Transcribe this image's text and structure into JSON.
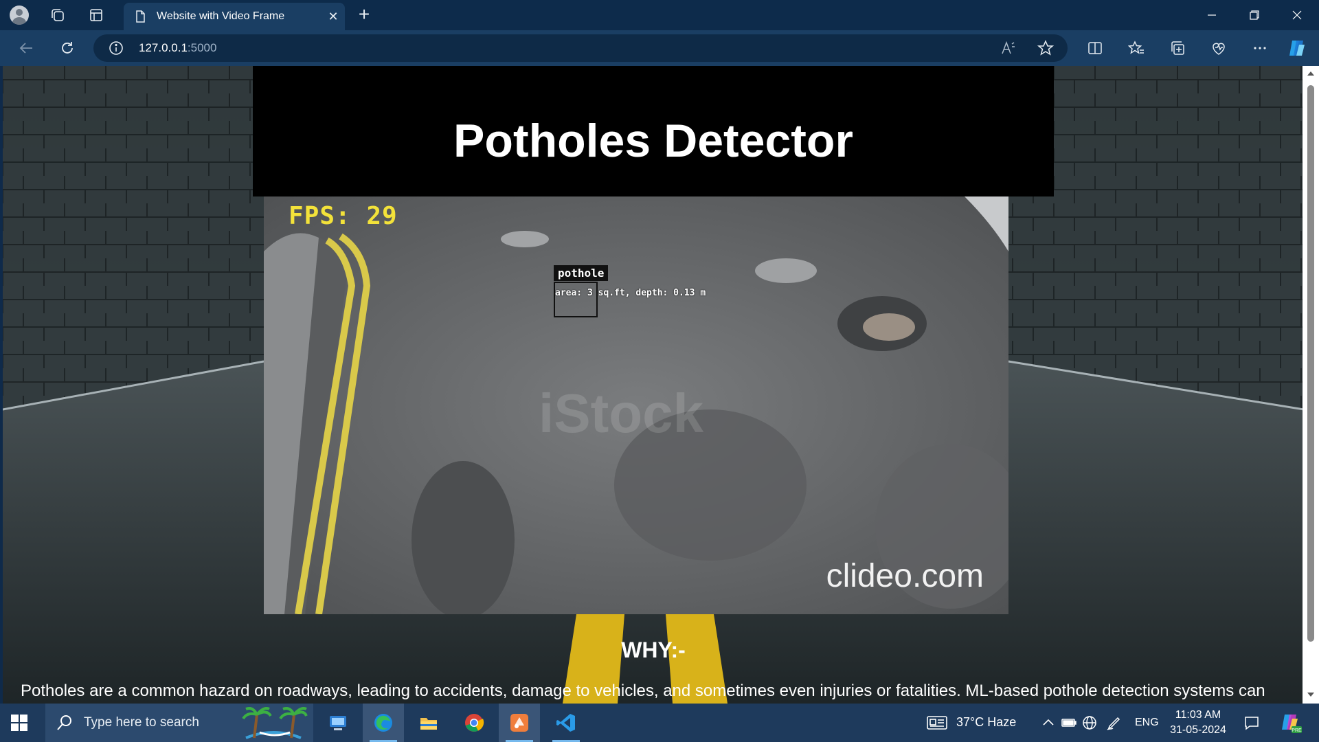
{
  "browser": {
    "tab_title": "Website with Video Frame",
    "url_host": "127.0.0.1",
    "url_port": ":5000"
  },
  "page": {
    "title": "Potholes Detector",
    "video": {
      "fps_label": "FPS: 29",
      "detection_label": "pothole",
      "detection_info": "area: 3 sq.ft, depth: 0.13 m",
      "watermark": "clideo.com",
      "stock_watermark": "iStock"
    },
    "why_heading": "WHY:-",
    "paragraph": "Potholes are a common hazard on roadways, leading to accidents, damage to vehicles, and sometimes even injuries or fatalities. ML-based pothole detection systems can"
  },
  "taskbar": {
    "search_placeholder": "Type here to search",
    "weather": "37°C  Haze",
    "language": "ENG",
    "time": "11:03 AM",
    "date": "31-05-2024"
  }
}
